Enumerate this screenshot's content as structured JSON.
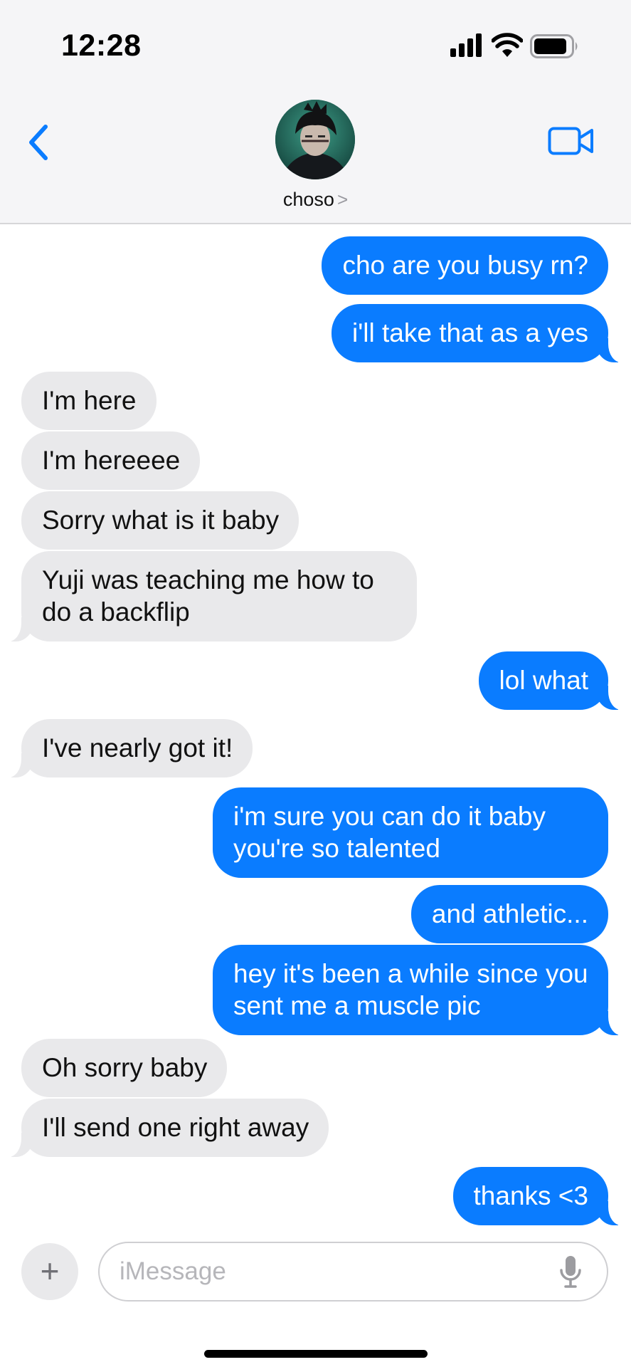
{
  "status_bar": {
    "time": "12:28"
  },
  "header": {
    "contact_name": "choso",
    "contact_chevron": ">"
  },
  "messages": [
    {
      "from": "me",
      "text": "cho are you busy rn?"
    },
    {
      "from": "me",
      "text": "i'll take that as a yes"
    },
    {
      "from": "them",
      "text": "I'm here"
    },
    {
      "from": "them",
      "text": "I'm hereeee"
    },
    {
      "from": "them",
      "text": "Sorry what is it baby"
    },
    {
      "from": "them",
      "text": "Yuji was teaching me how to do a backflip"
    },
    {
      "from": "me",
      "text": "lol what"
    },
    {
      "from": "them",
      "text": "I've nearly got it!"
    },
    {
      "from": "me",
      "text": "i'm sure you can do it baby you're so talented"
    },
    {
      "from": "me",
      "text": "and athletic..."
    },
    {
      "from": "me",
      "text": "hey it's been a while since you sent me a muscle pic"
    },
    {
      "from": "them",
      "text": "Oh sorry baby"
    },
    {
      "from": "them",
      "text": "I'll send one right away"
    },
    {
      "from": "me",
      "text": "thanks <3"
    }
  ],
  "compose": {
    "placeholder": "iMessage",
    "plus_label": "+"
  },
  "icons": {
    "back": "chevron-left-icon",
    "video": "video-camera-icon",
    "mic": "microphone-icon",
    "signal": "cellular-signal-icon",
    "wifi": "wifi-icon",
    "battery": "battery-icon"
  },
  "colors": {
    "sent_bubble": "#0a7cff",
    "received_bubble": "#e9e9eb",
    "accent": "#0a7cff"
  }
}
